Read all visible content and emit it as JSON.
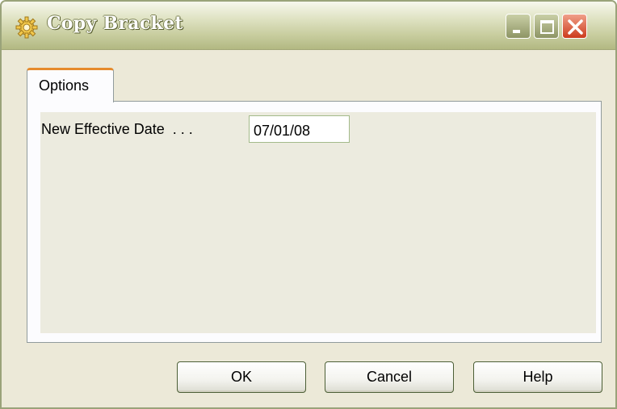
{
  "window": {
    "title": "Copy Bracket",
    "app_icon": "gear-icon",
    "controls": {
      "minimize_icon": "minimize-icon",
      "maximize_icon": "maximize-icon",
      "close_icon": "close-icon"
    }
  },
  "tabs": [
    {
      "label": "Options",
      "selected": true
    }
  ],
  "form": {
    "new_effective_date": {
      "label": "New Effective Date  . . .",
      "value": "07/01/08"
    }
  },
  "buttons": {
    "ok_label": "OK",
    "cancel_label": "Cancel",
    "help_label": "Help"
  },
  "colors": {
    "window_bg": "#ece9d8",
    "titlebar": "#c8cd9f",
    "tab_accent": "#e68b2c",
    "close_red": "#cc3b1c"
  }
}
